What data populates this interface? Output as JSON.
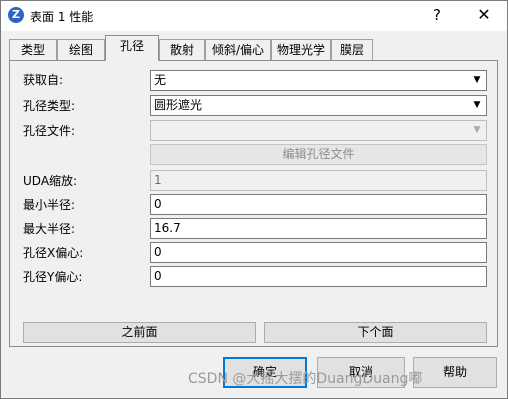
{
  "window": {
    "title": "表面 1 性能",
    "help_glyph": "?",
    "close_glyph": "✕",
    "app_icon_letter": "Z"
  },
  "tabs": [
    {
      "label": "类型"
    },
    {
      "label": "绘图"
    },
    {
      "label": "孔径",
      "active": true
    },
    {
      "label": "散射"
    },
    {
      "label": "倾斜/偏心"
    },
    {
      "label": "物理光学"
    },
    {
      "label": "膜层"
    }
  ],
  "form": {
    "source_label": "获取自:",
    "source_value": "无",
    "aperture_type_label": "孔径类型:",
    "aperture_type_value": "圆形遮光",
    "aperture_file_label": "孔径文件:",
    "aperture_file_value": "",
    "edit_file_button": "编辑孔径文件",
    "uda_scale_label": "UDA缩放:",
    "uda_scale_value": "1",
    "min_radius_label": "最小半径:",
    "min_radius_value": "0",
    "max_radius_label": "最大半径:",
    "max_radius_value": "16.7",
    "x_decenter_label": "孔径X偏心:",
    "x_decenter_value": "0",
    "y_decenter_label": "孔径Y偏心:",
    "y_decenter_value": "0"
  },
  "nav": {
    "prev_label": "之前面",
    "next_label": "下个面"
  },
  "footer": {
    "ok_label": "确定",
    "cancel_label": "取消",
    "help_label": "帮助"
  },
  "watermark": "CSDN @大摇大摆的DuangDuang嘟",
  "colors": {
    "window_bg": "#f0f0f0",
    "default_button_border": "#0078d7",
    "app_icon": "#2b63c6"
  }
}
